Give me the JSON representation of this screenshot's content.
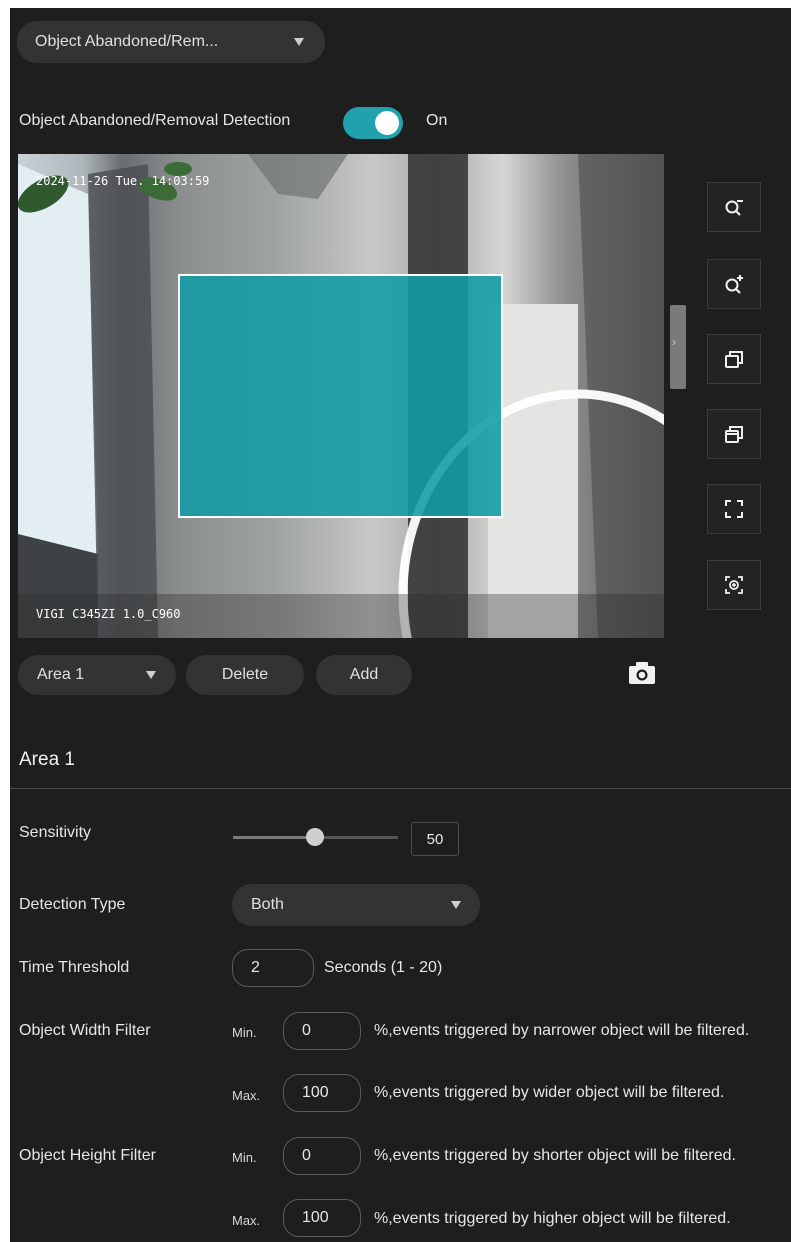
{
  "top_dropdown": {
    "label": "Object Abandoned/Rem..."
  },
  "detection_toggle": {
    "label": "Object Abandoned/Removal Detection",
    "state": "On"
  },
  "video": {
    "timestamp": "2024-11-26 Tue. 14:03:59",
    "camera_label": "VIGI C345ZI 1.0_C960"
  },
  "toolbar": {
    "icons": [
      "zoom-out-icon",
      "zoom-in-icon",
      "restore-window-icon",
      "window-copy-icon",
      "fullscreen-icon",
      "focus-target-icon"
    ]
  },
  "area_controls": {
    "selected_area": "Area 1",
    "delete_label": "Delete",
    "add_label": "Add"
  },
  "section": {
    "title": "Area 1"
  },
  "settings": {
    "sensitivity": {
      "label": "Sensitivity",
      "value": "50"
    },
    "detection_type": {
      "label": "Detection Type",
      "value": "Both"
    },
    "time_threshold": {
      "label": "Time Threshold",
      "value": "2",
      "unit": "Seconds (1 - 20)"
    },
    "width_filter": {
      "label": "Object Width Filter",
      "min_label": "Min.",
      "min_value": "0",
      "min_desc": "%,events triggered by narrower object will be filtered.",
      "max_label": "Max.",
      "max_value": "100",
      "max_desc": "%,events triggered by wider object will be filtered."
    },
    "height_filter": {
      "label": "Object Height Filter",
      "min_label": "Min.",
      "min_value": "0",
      "min_desc": "%,events triggered by shorter object will be filtered.",
      "max_label": "Max.",
      "max_value": "100",
      "max_desc": "%,events triggered by higher object will be filtered."
    }
  },
  "colors": {
    "accent": "#20a1ad",
    "panel_bg": "#1e1e1e",
    "control_bg": "#333333"
  }
}
